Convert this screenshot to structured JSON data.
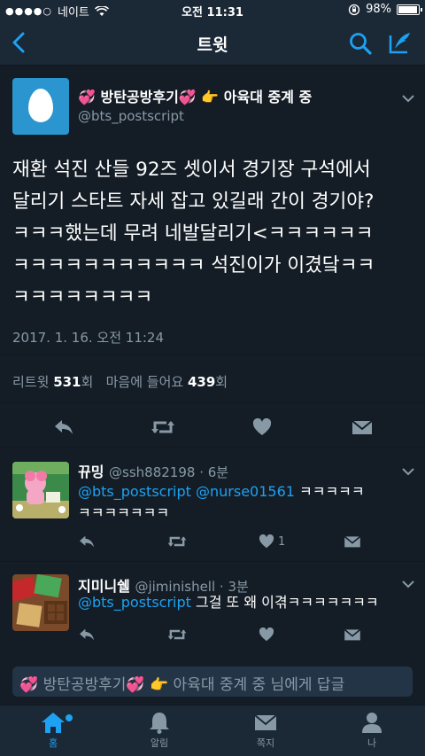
{
  "status_bar": {
    "carrier": "네이트",
    "signal_dots": "●●●●○",
    "time": "오전 11:31",
    "battery": "98%"
  },
  "nav": {
    "title": "트윗"
  },
  "tweet": {
    "name": "💞 방탄공방후기💞 👉 아육대 중계 중",
    "handle": "@bts_postscript",
    "text_lines": [
      "재환 석진 산들 92즈 셋이서 경기장 구석에서",
      "달리기 스타트 자세 잡고 있길래 간이 경기야?",
      "ㅋㅋㅋ했는데 무려 네발달리기<ㅋㅋㅋㅋㅋㅋ",
      "ㅋㅋㅋㅋㅋㅋㅋㅋㅋㅋㅋ 석진이가 이겼닼ㅋㅋ",
      "ㅋㅋㅋㅋㅋㅋㅋㅋ"
    ],
    "timestamp": "2017. 1. 16. 오전 11:24",
    "stats": {
      "retweets_label": "리트윗",
      "retweets": "531",
      "retweets_unit": "회",
      "likes_label": "마음에 들어요",
      "likes": "439",
      "likes_unit": "회"
    }
  },
  "replies": [
    {
      "name": "뀨밍",
      "handle_time": "@ssh882198 · 6분",
      "mentions": "@bts_postscript @nurse01561",
      "text_line1": " ㅋㅋㅋㅋㅋ",
      "text_line2": "ㅋㅋㅋㅋㅋㅋㅋ",
      "like_count": "1"
    },
    {
      "name": "지미니쉘",
      "handle_time": "@jiminishell · 3분",
      "mentions": "@bts_postscript",
      "text_line1": " 그걸 또 왜 이겪ㅋㅋㅋㅋㅋㅋㅋ",
      "like_count": ""
    }
  ],
  "reply_box": {
    "placeholder": "💞 방탄공방후기💞 👉 아육대 중계 중 님에게 답글"
  },
  "tabs": [
    {
      "label": "홈",
      "icon": "home-icon"
    },
    {
      "label": "알림",
      "icon": "bell-icon"
    },
    {
      "label": "쪽지",
      "icon": "envelope-icon"
    },
    {
      "label": "나",
      "icon": "person-icon"
    }
  ],
  "colors": {
    "background": "#141d26",
    "bar": "#1b2836",
    "accent": "#1da1f2",
    "muted": "#8899a6"
  }
}
